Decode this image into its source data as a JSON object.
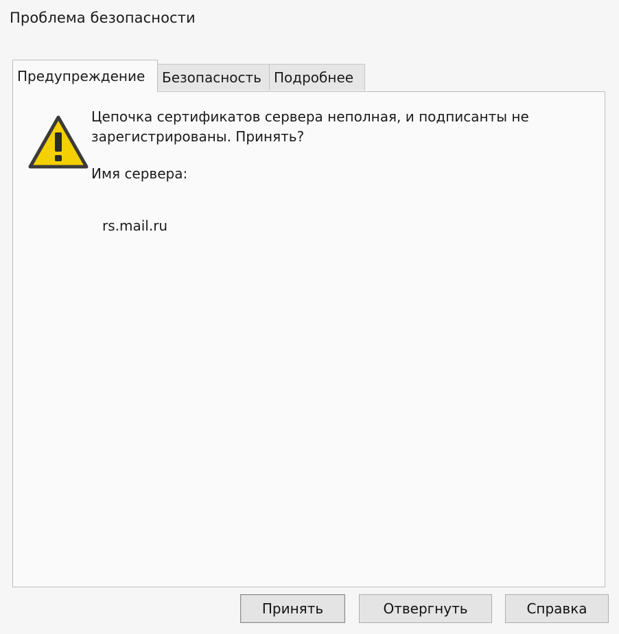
{
  "window": {
    "title": "Проблема безопасности"
  },
  "tabs": [
    {
      "label": "Предупреждение",
      "active": true
    },
    {
      "label": "Безопасность",
      "active": false
    },
    {
      "label": "Подробнее",
      "active": false
    }
  ],
  "warning": {
    "icon": "warning-triangle-icon",
    "message": "Цепочка сертификатов сервера неполная, и подписанты не зарегистрированы. Принять?",
    "server_label": "Имя сервера:",
    "server_name": "rs.mail.ru"
  },
  "buttons": {
    "accept": "Принять",
    "reject": "Отвергнуть",
    "help": "Справка"
  },
  "colors": {
    "warning_fill": "#f5d000",
    "warning_outline": "#3a3a3a"
  }
}
